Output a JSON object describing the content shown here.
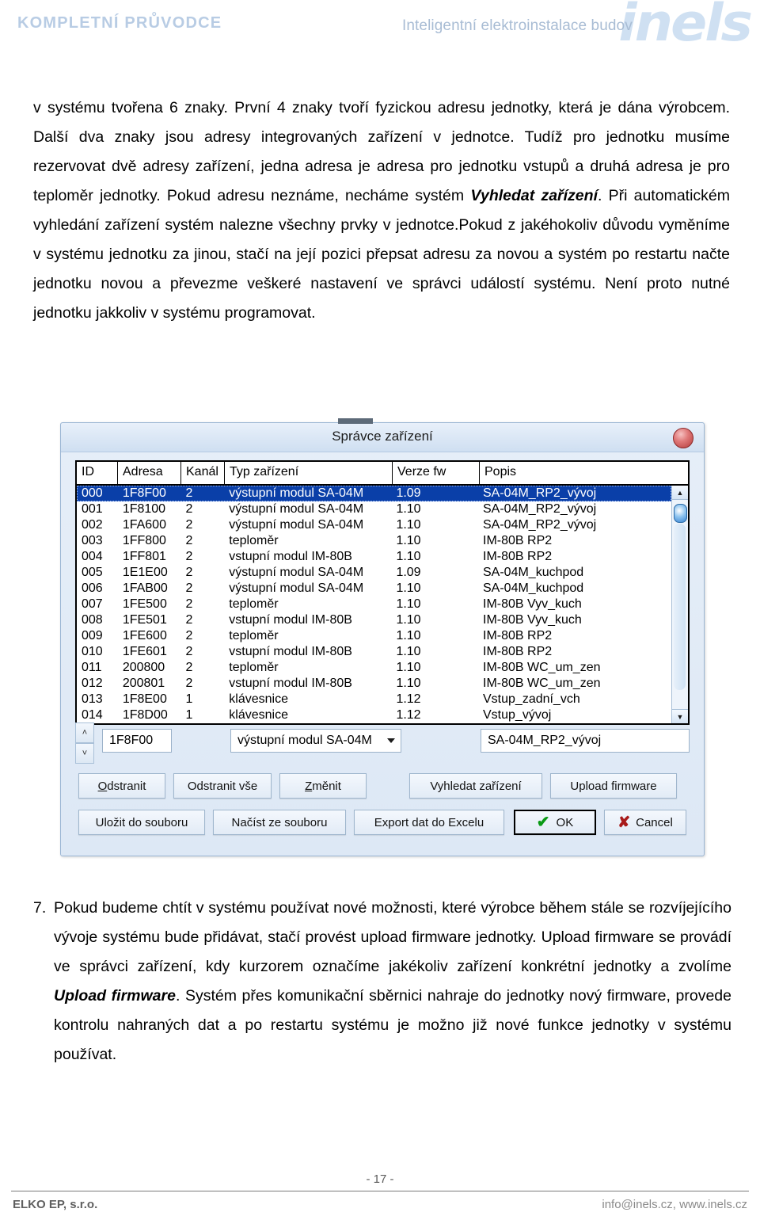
{
  "header": {
    "left_title": "KOMPLETNÍ PRŮVODCE",
    "right_subtitle": "Inteligentní elektroinstalace budov",
    "logo_text": "inels"
  },
  "paragraphs": {
    "top_part1": "v systému tvořena 6 znaky. První 4 znaky tvoří fyzickou adresu jednotky, která je dána výrobcem. Další dva znaky jsou adresy integrovaných zařízení v jednotce. Tudíž pro jednotku musíme rezervovat dvě adresy zařízení, jedna adresa je adresa pro jednotku vstupů a druhá adresa je pro teploměr jednotky. Pokud adresu neznáme, necháme systém ",
    "top_bold": "Vyhledat zařízení",
    "top_part2": ". Při automatickém vyhledání zařízení systém nalezne všechny prvky v jednotce.Pokud z jakéhokoliv důvodu vyměníme v systému jednotku za jinou, stačí na její pozici přepsat adresu za novou a systém po restartu načte jednotku novou a převezme veškeré nastavení ve správci událostí systému. Není proto nutné jednotku jakkoliv v systému programovat.",
    "bottom_number": "7.",
    "bottom_part1": "Pokud budeme chtít v systému používat nové možnosti, které výrobce během stále se rozvíjejícího vývoje systému bude přidávat, stačí provést upload firmware jednotky. Upload firmware se provádí ve správci zařízení, kdy kurzorem označíme jakékoliv zařízení konkrétní jednotky a zvolíme ",
    "bottom_bold": "Upload firmware",
    "bottom_part2": ". Systém přes komunikační sběrnici nahraje do jednotky nový firmware, provede kontrolu nahraných dat a po restartu systému je možno již nové funkce jednotky v systému používat."
  },
  "dialog": {
    "title": "Správce zařízení",
    "close_icon": "close-round-icon",
    "table": {
      "columns": [
        "ID",
        "Adresa",
        "Kanál",
        "Typ zařízení",
        "Verze fw",
        "Popis"
      ],
      "selected_index": 0,
      "rows": [
        [
          "000",
          "1F8F00",
          "2",
          "výstupní modul SA-04M",
          "1.09",
          "SA-04M_RP2_vývoj"
        ],
        [
          "001",
          "1F8100",
          "2",
          "výstupní modul SA-04M",
          "1.10",
          "SA-04M_RP2_vývoj"
        ],
        [
          "002",
          "1FA600",
          "2",
          "výstupní modul SA-04M",
          "1.10",
          "SA-04M_RP2_vývoj"
        ],
        [
          "003",
          "1FF800",
          "2",
          "teploměr",
          "1.10",
          "IM-80B RP2"
        ],
        [
          "004",
          "1FF801",
          "2",
          "vstupní modul IM-80B",
          "1.10",
          "IM-80B RP2"
        ],
        [
          "005",
          "1E1E00",
          "2",
          "výstupní modul SA-04M",
          "1.09",
          "SA-04M_kuchpod"
        ],
        [
          "006",
          "1FAB00",
          "2",
          "výstupní modul SA-04M",
          "1.10",
          "SA-04M_kuchpod"
        ],
        [
          "007",
          "1FE500",
          "2",
          "teploměr",
          "1.10",
          "IM-80B Vyv_kuch"
        ],
        [
          "008",
          "1FE501",
          "2",
          "vstupní modul IM-80B",
          "1.10",
          "IM-80B Vyv_kuch"
        ],
        [
          "009",
          "1FE600",
          "2",
          "teploměr",
          "1.10",
          "IM-80B RP2"
        ],
        [
          "010",
          "1FE601",
          "2",
          "vstupní modul IM-80B",
          "1.10",
          "IM-80B RP2"
        ],
        [
          "011",
          "200800",
          "2",
          "teploměr",
          "1.10",
          "IM-80B WC_um_zen"
        ],
        [
          "012",
          "200801",
          "2",
          "vstupní modul IM-80B",
          "1.10",
          "IM-80B WC_um_zen"
        ],
        [
          "013",
          "1F8E00",
          "1",
          "klávesnice",
          "1.12",
          "Vstup_zadní_vch"
        ],
        [
          "014",
          "1F8D00",
          "1",
          "klávesnice",
          "1.12",
          "Vstup_vývoj"
        ]
      ]
    },
    "edit_row": {
      "address_value": "1F8F00",
      "type_value": "výstupní modul SA-04M",
      "description_value": "SA-04M_RP2_vývoj",
      "spin_up": "˄",
      "spin_down": "˅"
    },
    "buttons": {
      "odstranit": "Odstranit",
      "odstranit_accel": "O",
      "odstranit_rest": "dstranit",
      "odstranit_vse": "Odstranit vše",
      "zmenit_accel": "Z",
      "zmenit_rest": "měnit",
      "vyhledat_zarizeni": "Vyhledat zařízení",
      "upload_firmware": "Upload firmware",
      "ulozit_do_souboru": "Uložit do souboru",
      "nacist_ze_souboru": "Načíst ze souboru",
      "export_dat": "Export dat do Excelu",
      "ok": "OK",
      "cancel": "Cancel"
    },
    "scrollbar": {
      "up_arrow": "▲",
      "down_arrow": "▼"
    }
  },
  "footer": {
    "page_number": "- 17 -",
    "company": "ELKO EP, s.r.o.",
    "contact": "info@inels.cz,  www.inels.cz"
  }
}
